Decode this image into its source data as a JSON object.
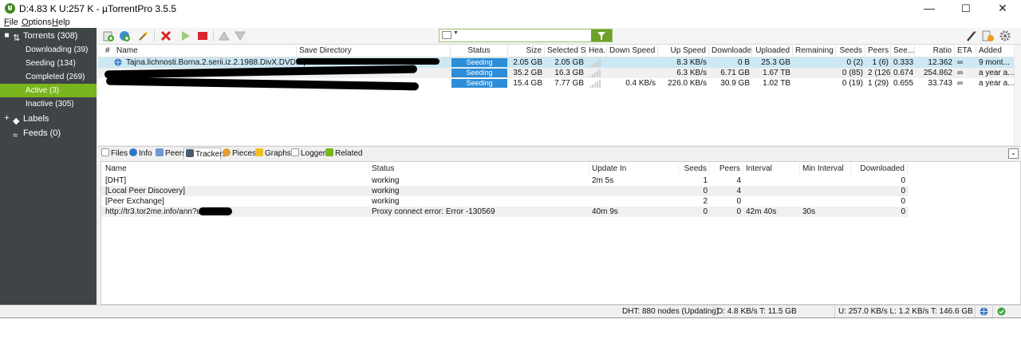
{
  "window": {
    "title": "D:4.83 K U:257 K - µTorrentPro 3.5.5",
    "controls": [
      "—",
      "☐",
      "✕"
    ]
  },
  "menu": [
    {
      "key": "F",
      "rest": "ile"
    },
    {
      "key": "O",
      "rest": "ptions"
    },
    {
      "key": "H",
      "rest": "elp"
    }
  ],
  "sidebar": {
    "torrents_label": "Torrents (308)",
    "items": [
      {
        "label": "Downloading (39)",
        "active": false
      },
      {
        "label": "Seeding (134)",
        "active": false
      },
      {
        "label": "Completed (269)",
        "active": false
      },
      {
        "label": "Active (3)",
        "active": true
      },
      {
        "label": "Inactive (305)",
        "active": false
      }
    ],
    "labels_label": "Labels",
    "feeds_label": "Feeds (0)",
    "collapse_symbol": "■",
    "expand_symbol": "+"
  },
  "search": {
    "value": ""
  },
  "colors": {
    "sidebar_bg": "#3f4447",
    "active_green": "#7ab51d",
    "seeding_blue": "#2d8dd8",
    "selected_row": "#cce8f4"
  },
  "torrent_columns": [
    "#",
    "Name",
    "Save Directory",
    "Status",
    "Size",
    "Selected S...",
    "Hea...",
    "Down Speed",
    "Up Speed",
    "Downloaded",
    "Uploaded",
    "Remaining",
    "Seeds",
    "Peers",
    "See...",
    "Ratio",
    "ETA",
    "Added"
  ],
  "torrents": [
    {
      "name": "Tajna.lichnosti.Borna.2.serii.iz.2.1988.DivX.DVDRip-Kinozal...",
      "status": "Seeding",
      "size": "2.05 GB",
      "selected": "2.05 GB",
      "down": "",
      "up": "8.3 KB/s",
      "downloaded": "0 B",
      "uploaded": "25.3 GB",
      "remaining": "",
      "seeds": "0 (2)",
      "peers": "1 (6)",
      "seedratio": "0.333",
      "ratio": "12.362",
      "eta": "∞",
      "added": "9 mont..."
    },
    {
      "name": "",
      "status": "Seeding",
      "size": "35.2 GB",
      "selected": "16.3 GB",
      "down": "",
      "up": "6.3 KB/s",
      "downloaded": "6.71 GB",
      "uploaded": "1.67 TB",
      "remaining": "",
      "seeds": "0 (85)",
      "peers": "2 (126)",
      "seedratio": "0.674",
      "ratio": "254.862",
      "eta": "∞",
      "added": "a year a..."
    },
    {
      "name": "",
      "status": "Seeding",
      "size": "15.4 GB",
      "selected": "7.77 GB",
      "down": "0.4 KB/s",
      "up": "226.0 KB/s",
      "downloaded": "30.9 GB",
      "uploaded": "1.02 TB",
      "remaining": "",
      "seeds": "0 (19)",
      "peers": "1 (29)",
      "seedratio": "0.655",
      "ratio": "33.743",
      "eta": "∞",
      "added": "a year a..."
    }
  ],
  "tabs": [
    {
      "label": "Files",
      "icon": "files-icon",
      "active": false
    },
    {
      "label": "Info",
      "icon": "info-icon",
      "active": false
    },
    {
      "label": "Peers",
      "icon": "peers-icon",
      "active": false
    },
    {
      "label": "Trackers",
      "icon": "trackers-icon",
      "active": true
    },
    {
      "label": "Pieces",
      "icon": "pieces-icon",
      "active": false
    },
    {
      "label": "Graphs",
      "icon": "graphs-icon",
      "active": false
    },
    {
      "label": "Logger",
      "icon": "logger-icon",
      "active": false
    },
    {
      "label": "Related",
      "icon": "related-icon",
      "active": false
    }
  ],
  "tracker_columns": [
    "Name",
    "Status",
    "Update In",
    "Seeds",
    "Peers",
    "Interval",
    "Min Interval",
    "Downloaded"
  ],
  "trackers": [
    {
      "name": "[DHT]",
      "status": "working",
      "update": "2m 5s",
      "seeds": "1",
      "peers": "4",
      "interval": "",
      "min_interval": "",
      "downloaded": "0"
    },
    {
      "name": "[Local Peer Discovery]",
      "status": "working",
      "update": "",
      "seeds": "0",
      "peers": "4",
      "interval": "",
      "min_interval": "",
      "downloaded": "0"
    },
    {
      "name": "[Peer Exchange]",
      "status": "working",
      "update": "",
      "seeds": "2",
      "peers": "0",
      "interval": "",
      "min_interval": "",
      "downloaded": "0"
    },
    {
      "name": "http://tr3.tor2me.info/ann?uk=",
      "status": "Proxy connect error: Error -130569",
      "update": "40m 9s",
      "seeds": "0",
      "peers": "0",
      "interval": "42m 40s",
      "min_interval": "30s",
      "downloaded": "0"
    }
  ],
  "statusbar": {
    "dht": "DHT: 880 nodes (Updating)",
    "down": "D: 4.8 KB/s T: 11.5 GB",
    "up": "U: 257.0 KB/s L: 1.2 KB/s T: 146.6 GB"
  }
}
